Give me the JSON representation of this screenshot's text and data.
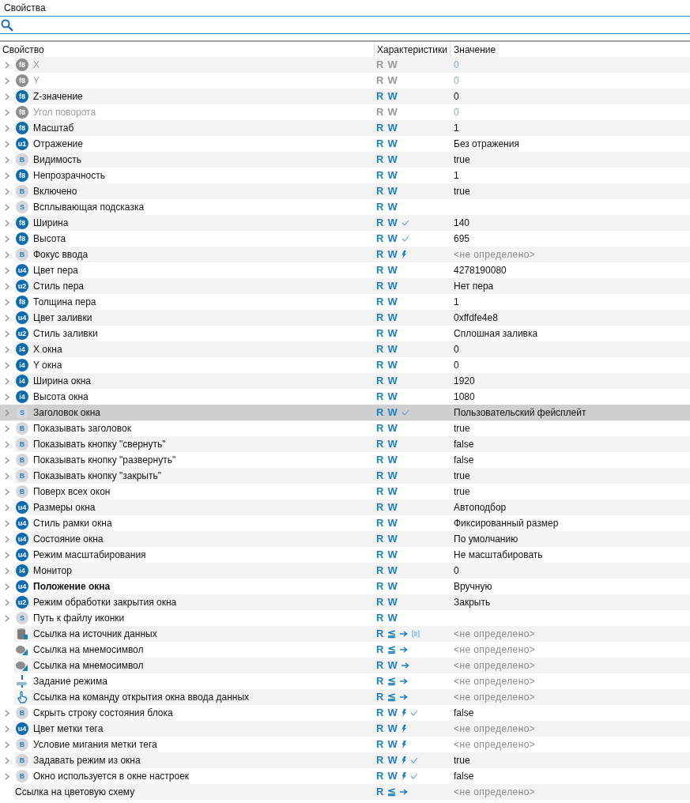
{
  "panel": {
    "title": "Свойства"
  },
  "columns": [
    "Свойство",
    "Характеристики",
    "Значение"
  ],
  "rows": [
    {
      "name": "X",
      "badge": "f8",
      "kind": "numeric",
      "expandable": true,
      "disabled": true,
      "selected": false,
      "bold": false,
      "access": [
        "R",
        "W"
      ],
      "event": false,
      "applied": false,
      "reference": false,
      "list": false,
      "value": "0",
      "undefined": false
    },
    {
      "name": "Y",
      "badge": "f8",
      "kind": "numeric",
      "expandable": true,
      "disabled": true,
      "selected": false,
      "bold": false,
      "access": [
        "R",
        "W"
      ],
      "event": false,
      "applied": false,
      "reference": false,
      "list": false,
      "value": "0",
      "undefined": false
    },
    {
      "name": "Z-значение",
      "badge": "f8",
      "kind": "numeric",
      "expandable": true,
      "disabled": false,
      "selected": false,
      "bold": false,
      "access": [
        "R",
        "W"
      ],
      "event": false,
      "applied": false,
      "reference": false,
      "list": false,
      "value": "0",
      "undefined": false
    },
    {
      "name": "Угол поворота",
      "badge": "f8",
      "kind": "numeric",
      "expandable": true,
      "disabled": true,
      "selected": false,
      "bold": false,
      "access": [
        "R",
        "W"
      ],
      "event": false,
      "applied": false,
      "reference": false,
      "list": false,
      "value": "0",
      "undefined": false
    },
    {
      "name": "Масштаб",
      "badge": "f8",
      "kind": "numeric",
      "expandable": true,
      "disabled": false,
      "selected": false,
      "bold": false,
      "access": [
        "R",
        "W"
      ],
      "event": false,
      "applied": false,
      "reference": false,
      "list": false,
      "value": "1",
      "undefined": false
    },
    {
      "name": "Отражение",
      "badge": "u1",
      "kind": "numeric",
      "expandable": true,
      "disabled": false,
      "selected": false,
      "bold": false,
      "access": [
        "R",
        "W"
      ],
      "event": false,
      "applied": false,
      "reference": false,
      "list": false,
      "value": "Без отражения",
      "undefined": false
    },
    {
      "name": "Видимость",
      "badge": "B",
      "kind": "flag",
      "expandable": true,
      "disabled": false,
      "selected": false,
      "bold": false,
      "access": [
        "R",
        "W"
      ],
      "event": false,
      "applied": false,
      "reference": false,
      "list": false,
      "value": "true",
      "undefined": false
    },
    {
      "name": "Непрозрачность",
      "badge": "f8",
      "kind": "numeric",
      "expandable": true,
      "disabled": false,
      "selected": false,
      "bold": false,
      "access": [
        "R",
        "W"
      ],
      "event": false,
      "applied": false,
      "reference": false,
      "list": false,
      "value": "1",
      "undefined": false
    },
    {
      "name": "Включено",
      "badge": "B",
      "kind": "flag",
      "expandable": true,
      "disabled": false,
      "selected": false,
      "bold": false,
      "access": [
        "R",
        "W"
      ],
      "event": false,
      "applied": false,
      "reference": false,
      "list": false,
      "value": "true",
      "undefined": false
    },
    {
      "name": "Всплывающая подсказка",
      "badge": "S",
      "kind": "flag",
      "expandable": true,
      "disabled": false,
      "selected": false,
      "bold": false,
      "access": [
        "R",
        "W"
      ],
      "event": false,
      "applied": false,
      "reference": false,
      "list": false
    },
    {
      "name": "Ширина",
      "badge": "f8",
      "kind": "numeric",
      "expandable": true,
      "disabled": false,
      "selected": false,
      "bold": false,
      "access": [
        "R",
        "W"
      ],
      "event": false,
      "applied": true,
      "reference": false,
      "list": false,
      "value": "140",
      "undefined": false
    },
    {
      "name": "Высота",
      "badge": "f8",
      "kind": "numeric",
      "expandable": true,
      "disabled": false,
      "selected": false,
      "bold": false,
      "access": [
        "R",
        "W"
      ],
      "event": false,
      "applied": true,
      "reference": false,
      "list": false,
      "value": "695",
      "undefined": false
    },
    {
      "name": "Фокус ввода",
      "badge": "B",
      "kind": "flag",
      "expandable": true,
      "disabled": false,
      "selected": false,
      "bold": false,
      "access": [
        "R",
        "W"
      ],
      "event": true,
      "applied": false,
      "reference": false,
      "list": false,
      "value": "<не определено>",
      "undefined": true
    },
    {
      "name": "Цвет пера",
      "badge": "u4",
      "kind": "numeric",
      "expandable": true,
      "disabled": false,
      "selected": false,
      "bold": false,
      "access": [
        "R",
        "W"
      ],
      "event": false,
      "applied": false,
      "reference": false,
      "list": false,
      "value": "4278190080",
      "undefined": false
    },
    {
      "name": "Стиль пера",
      "badge": "u2",
      "kind": "numeric",
      "expandable": true,
      "disabled": false,
      "selected": false,
      "bold": false,
      "access": [
        "R",
        "W"
      ],
      "event": false,
      "applied": false,
      "reference": false,
      "list": false,
      "value": "Нет пера",
      "undefined": false
    },
    {
      "name": "Толщина пера",
      "badge": "f8",
      "kind": "numeric",
      "expandable": true,
      "disabled": false,
      "selected": false,
      "bold": false,
      "access": [
        "R",
        "W"
      ],
      "event": false,
      "applied": false,
      "reference": false,
      "list": false,
      "value": "1",
      "undefined": false
    },
    {
      "name": "Цвет заливки",
      "badge": "u4",
      "kind": "numeric",
      "expandable": true,
      "disabled": false,
      "selected": false,
      "bold": false,
      "access": [
        "R",
        "W"
      ],
      "event": false,
      "applied": false,
      "reference": false,
      "list": false,
      "value": "0xffdfe4e8",
      "undefined": false
    },
    {
      "name": "Стиль заливки",
      "badge": "u2",
      "kind": "numeric",
      "expandable": true,
      "disabled": false,
      "selected": false,
      "bold": false,
      "access": [
        "R",
        "W"
      ],
      "event": false,
      "applied": false,
      "reference": false,
      "list": false,
      "value": "Сплошная заливка",
      "undefined": false
    },
    {
      "name": "X окна",
      "badge": "i4",
      "kind": "numeric",
      "expandable": true,
      "disabled": false,
      "selected": false,
      "bold": false,
      "access": [
        "R",
        "W"
      ],
      "event": false,
      "applied": false,
      "reference": false,
      "list": false,
      "value": "0",
      "undefined": false
    },
    {
      "name": "Y окна",
      "badge": "i4",
      "kind": "numeric",
      "expandable": true,
      "disabled": false,
      "selected": false,
      "bold": false,
      "access": [
        "R",
        "W"
      ],
      "event": false,
      "applied": false,
      "reference": false,
      "list": false,
      "value": "0",
      "undefined": false
    },
    {
      "name": "Ширина окна",
      "badge": "i4",
      "kind": "numeric",
      "expandable": true,
      "disabled": false,
      "selected": false,
      "bold": false,
      "access": [
        "R",
        "W"
      ],
      "event": false,
      "applied": false,
      "reference": false,
      "list": false,
      "value": "1920",
      "undefined": false
    },
    {
      "name": "Высота окна",
      "badge": "i4",
      "kind": "numeric",
      "expandable": true,
      "disabled": false,
      "selected": false,
      "bold": false,
      "access": [
        "R",
        "W"
      ],
      "event": false,
      "applied": false,
      "reference": false,
      "list": false,
      "value": "1080",
      "undefined": false
    },
    {
      "name": "Заголовок окна",
      "badge": "S",
      "kind": "flag",
      "expandable": true,
      "disabled": false,
      "selected": true,
      "bold": false,
      "access": [
        "R",
        "W"
      ],
      "event": false,
      "applied": true,
      "reference": false,
      "list": false,
      "value": "Пользовательский фейсплейт",
      "undefined": false
    },
    {
      "name": "Показывать заголовок",
      "badge": "B",
      "kind": "flag",
      "expandable": true,
      "disabled": false,
      "selected": false,
      "bold": false,
      "access": [
        "R",
        "W"
      ],
      "event": false,
      "applied": false,
      "reference": false,
      "list": false,
      "value": "true",
      "undefined": false
    },
    {
      "name": "Показывать кнопку \"свернуть\"",
      "badge": "B",
      "kind": "flag",
      "expandable": true,
      "disabled": false,
      "selected": false,
      "bold": false,
      "access": [
        "R",
        "W"
      ],
      "event": false,
      "applied": false,
      "reference": false,
      "list": false,
      "value": "false",
      "undefined": false
    },
    {
      "name": "Показывать кнопку \"развернуть\"",
      "badge": "B",
      "kind": "flag",
      "expandable": true,
      "disabled": false,
      "selected": false,
      "bold": false,
      "access": [
        "R",
        "W"
      ],
      "event": false,
      "applied": false,
      "reference": false,
      "list": false,
      "value": "false",
      "undefined": false
    },
    {
      "name": "Показывать кнопку \"закрыть\"",
      "badge": "B",
      "kind": "flag",
      "expandable": true,
      "disabled": false,
      "selected": false,
      "bold": false,
      "access": [
        "R",
        "W"
      ],
      "event": false,
      "applied": false,
      "reference": false,
      "list": false,
      "value": "true",
      "undefined": false
    },
    {
      "name": "Поверх всех окон",
      "badge": "B",
      "kind": "flag",
      "expandable": true,
      "disabled": false,
      "selected": false,
      "bold": false,
      "access": [
        "R",
        "W"
      ],
      "event": false,
      "applied": false,
      "reference": false,
      "list": false,
      "value": "true",
      "undefined": false
    },
    {
      "name": "Размеры окна",
      "badge": "u4",
      "kind": "numeric",
      "expandable": true,
      "disabled": false,
      "selected": false,
      "bold": false,
      "access": [
        "R",
        "W"
      ],
      "event": false,
      "applied": false,
      "reference": false,
      "list": false,
      "value": "Автоподбор",
      "undefined": false
    },
    {
      "name": "Стиль рамки окна",
      "badge": "u4",
      "kind": "numeric",
      "expandable": true,
      "disabled": false,
      "selected": false,
      "bold": false,
      "access": [
        "R",
        "W"
      ],
      "event": false,
      "applied": false,
      "reference": false,
      "list": false,
      "value": "Фиксированный размер",
      "undefined": false
    },
    {
      "name": "Состояние окна",
      "badge": "u4",
      "kind": "numeric",
      "expandable": true,
      "disabled": false,
      "selected": false,
      "bold": false,
      "access": [
        "R",
        "W"
      ],
      "event": false,
      "applied": false,
      "reference": false,
      "list": false,
      "value": "По умолчанию",
      "undefined": false
    },
    {
      "name": "Режим масштабирования",
      "badge": "u4",
      "kind": "numeric",
      "expandable": true,
      "disabled": false,
      "selected": false,
      "bold": false,
      "access": [
        "R",
        "W"
      ],
      "event": false,
      "applied": false,
      "reference": false,
      "list": false,
      "value": "Не масштабировать",
      "undefined": false
    },
    {
      "name": "Монитор",
      "badge": "i4",
      "kind": "numeric",
      "expandable": true,
      "disabled": false,
      "selected": false,
      "bold": false,
      "access": [
        "R",
        "W"
      ],
      "event": false,
      "applied": false,
      "reference": false,
      "list": false,
      "value": "0",
      "undefined": false
    },
    {
      "name": "Положение окна",
      "badge": "u4",
      "kind": "numeric",
      "expandable": true,
      "disabled": false,
      "selected": false,
      "bold": true,
      "access": [
        "R",
        "W"
      ],
      "event": false,
      "applied": false,
      "reference": false,
      "list": false,
      "value": "Вручную",
      "undefined": false
    },
    {
      "name": "Режим обработки закрытия окна",
      "badge": "u2",
      "kind": "numeric",
      "expandable": true,
      "disabled": false,
      "selected": false,
      "bold": false,
      "access": [
        "R",
        "W"
      ],
      "event": false,
      "applied": false,
      "reference": false,
      "list": false,
      "value": "Закрыть",
      "undefined": false
    },
    {
      "name": "Путь к файлу иконки",
      "badge": "S",
      "kind": "flag",
      "expandable": true,
      "disabled": false,
      "selected": false,
      "bold": false,
      "access": [
        "R",
        "W"
      ],
      "event": false,
      "applied": false,
      "reference": false,
      "list": false
    },
    {
      "name": "Ссылка на источник данных",
      "kind": "database",
      "expandable": false,
      "disabled": false,
      "selected": false,
      "bold": false,
      "access": [
        "R",
        "≦"
      ],
      "event": false,
      "applied": false,
      "reference": true,
      "list": true,
      "value": "<не определено>",
      "undefined": true
    },
    {
      "name": "Ссылка на мнемосимвол",
      "kind": "symbol",
      "expandable": false,
      "disabled": false,
      "selected": false,
      "bold": false,
      "access": [
        "R",
        "≦"
      ],
      "event": false,
      "applied": false,
      "reference": true,
      "list": false,
      "value": "<не определено>",
      "undefined": true
    },
    {
      "name": "Ссылка на мнемосимвол",
      "kind": "symbol",
      "expandable": false,
      "disabled": false,
      "selected": false,
      "bold": false,
      "access": [
        "R",
        "W"
      ],
      "event": false,
      "applied": false,
      "reference": true,
      "list": false,
      "value": "<не определено>",
      "undefined": true
    },
    {
      "name": "Задание режима",
      "kind": "mode",
      "expandable": false,
      "disabled": false,
      "selected": false,
      "bold": false,
      "access": [
        "R",
        "≦"
      ],
      "event": false,
      "applied": false,
      "reference": true,
      "list": false,
      "value": "<не определено>",
      "undefined": true
    },
    {
      "name": "Ссылка на команду открытия окна ввода данных",
      "kind": "touch",
      "expandable": false,
      "disabled": false,
      "selected": false,
      "bold": false,
      "access": [
        "R",
        "≦"
      ],
      "event": false,
      "applied": false,
      "reference": true,
      "list": false,
      "value": "<не определено>",
      "undefined": true
    },
    {
      "name": "Скрыть строку состояния блока",
      "badge": "B",
      "kind": "flag",
      "expandable": true,
      "disabled": false,
      "selected": false,
      "bold": false,
      "access": [
        "R",
        "W"
      ],
      "event": true,
      "applied": true,
      "reference": false,
      "list": false,
      "value": "false",
      "undefined": false
    },
    {
      "name": "Цвет метки тега",
      "badge": "u4",
      "kind": "numeric",
      "expandable": true,
      "disabled": false,
      "selected": false,
      "bold": false,
      "access": [
        "R",
        "W"
      ],
      "event": true,
      "applied": false,
      "reference": false,
      "list": false,
      "value": "<не определено>",
      "undefined": true
    },
    {
      "name": "Условие мигания метки тега",
      "badge": "B",
      "kind": "flag",
      "expandable": true,
      "disabled": false,
      "selected": false,
      "bold": false,
      "access": [
        "R",
        "W"
      ],
      "event": true,
      "applied": false,
      "reference": false,
      "list": false,
      "value": "<не определено>",
      "undefined": true
    },
    {
      "name": "Задавать режим из окна",
      "badge": "B",
      "kind": "flag",
      "expandable": true,
      "disabled": false,
      "selected": false,
      "bold": false,
      "access": [
        "R",
        "W"
      ],
      "event": true,
      "applied": true,
      "reference": false,
      "list": false,
      "value": "true",
      "undefined": false
    },
    {
      "name": "Окно используется в окне настроек",
      "badge": "B",
      "kind": "flag",
      "expandable": true,
      "disabled": false,
      "selected": false,
      "bold": false,
      "access": [
        "R",
        "W"
      ],
      "event": true,
      "applied": true,
      "reference": false,
      "list": false,
      "value": "false",
      "undefined": false
    },
    {
      "name": "Ссылка на цветовую схему",
      "kind": "plain",
      "expandable": false,
      "disabled": false,
      "selected": false,
      "bold": false,
      "access": [
        "R",
        "≦"
      ],
      "event": false,
      "applied": false,
      "reference": true,
      "list": false,
      "value": "<не определено>",
      "undefined": true
    }
  ]
}
